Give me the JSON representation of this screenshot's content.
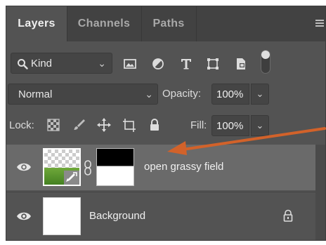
{
  "tabs": [
    {
      "label": "Layers",
      "active": true
    },
    {
      "label": "Channels",
      "active": false
    },
    {
      "label": "Paths",
      "active": false
    }
  ],
  "filter": {
    "kind_label": "Kind",
    "icons": [
      "image-filter-icon",
      "adjustment-filter-icon",
      "type-filter-icon",
      "shape-filter-icon",
      "smart-object-filter-icon",
      "filter-toggle"
    ]
  },
  "blend": {
    "mode": "Normal",
    "opacity_label": "Opacity:",
    "opacity_value": "100%"
  },
  "lock": {
    "label": "Lock:",
    "icons": [
      "lock-transparent-icon",
      "lock-image-icon",
      "lock-position-icon",
      "lock-artboard-icon",
      "lock-all-icon"
    ],
    "fill_label": "Fill:",
    "fill_value": "100%"
  },
  "layers": [
    {
      "name": "open grassy field",
      "visible": true,
      "selected": true,
      "has_mask": true,
      "smart_object": true
    },
    {
      "name": "Background",
      "visible": true,
      "selected": false,
      "locked": true
    }
  ],
  "colors": {
    "panel_bg": "#535353",
    "tab_bar_bg": "#424242",
    "selected_row": "#6a6a6a",
    "annotation_arrow": "#d2622a"
  }
}
